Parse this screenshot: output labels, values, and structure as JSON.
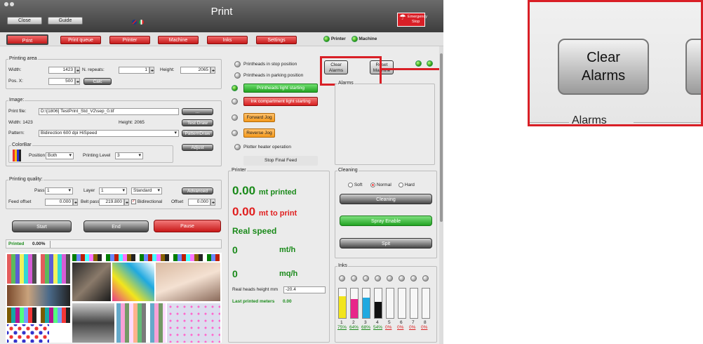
{
  "window": {
    "title": "Print",
    "close_label": "Close",
    "guide_label": "Guide"
  },
  "emergency": {
    "label_line1": "Emergency",
    "label_line2": "Stop"
  },
  "tabs": [
    "Print",
    "Print queue",
    "Printer",
    "Machine",
    "Inks",
    "Settings"
  ],
  "status": {
    "printer": "Printer",
    "machine": "Machine"
  },
  "printing_area": {
    "legend": "Printing area",
    "width_label": "Width:",
    "width_value": "1423",
    "repeats_label": "N. repeats:",
    "repeats_value": "1",
    "height_label": "Height:",
    "height_value": "2065",
    "posx_label": "Pos. X:",
    "posx_value": "500",
    "calc_label": "Calc"
  },
  "image": {
    "legend": "Image:",
    "file_label": "Print file:",
    "file_value": "D:\\[1806] TestPrint_Std_V2\\sep_0.tif",
    "browse_label": "...",
    "width_text": "Width: 1423",
    "height_text": "Height: 2065",
    "test_draw": "Test Draw",
    "pattern_label": "Pattern:",
    "pattern_value": "Bidirection 600 dpi HiSpeed",
    "pattern_draw": "PatternDraw",
    "adjust": "Adjust",
    "colorbar_legend": "ColorBar",
    "position_label": "Position",
    "position_value": "Both",
    "level_label": "Printing Level",
    "level_value": "3"
  },
  "quality": {
    "legend": "Printing quality:",
    "pass_label": "Pass",
    "pass_value": "1",
    "layer_label": "Layer",
    "layer_value": "1",
    "mode_value": "Standard",
    "advanced": "Advanced",
    "feed_label": "Feed offset",
    "feed_value": "0.000",
    "belt_label": "Belt pass",
    "belt_value": "219.800",
    "bidirectional": "Bidirectional",
    "offset_label": "Offset",
    "offset_value": "0.000"
  },
  "controls": {
    "start": "Start",
    "end": "End",
    "pause": "Pause"
  },
  "progress": {
    "label": "Printed",
    "value": "0.00%"
  },
  "heads": {
    "stop": "Printheads in stop position",
    "parking": "Printheads in parking position",
    "light": "Printheads light starting",
    "ink_light": "Ink compartment light starting",
    "forward": "Forward Jog",
    "reverse": "Reverse Jog",
    "heater": "Plotter heater operation",
    "stop_feed": "Stop Final Feed"
  },
  "alarm_buttons": {
    "clear_line1": "Clear",
    "clear_line2": "Alarms",
    "reset_line1": "Reset",
    "reset_line2": "Machine",
    "alarms_legend": "Alarms"
  },
  "printer_panel": {
    "legend": "Printer",
    "printed_value": "0.00",
    "printed_unit": "mt printed",
    "toprint_value": "0.00",
    "toprint_unit": "mt to print",
    "speed_label": "Real speed",
    "mth_value": "0",
    "mth_unit": "mt/h",
    "mqh_value": "0",
    "mqh_unit": "mq/h",
    "heads_height_label": "Real heads height mm",
    "heads_height_value": "-20.4",
    "last_printed": "Last printed meters",
    "last_value": "0.00"
  },
  "cleaning": {
    "legend": "Cleaning",
    "soft": "Soft",
    "normal": "Normal",
    "hard": "Hard",
    "cleaning_btn": "Cleaning",
    "spray": "Spray Enable",
    "spit": "Spit"
  },
  "inks": {
    "legend": "Inks",
    "channels": [
      {
        "n": "1",
        "pct": "75%",
        "level": 0.75,
        "color": "#f2e51c"
      },
      {
        "n": "2",
        "pct": "64%",
        "level": 0.64,
        "color": "#e8268a"
      },
      {
        "n": "3",
        "pct": "68%",
        "level": 0.68,
        "color": "#1fa9e0"
      },
      {
        "n": "4",
        "pct": "54%",
        "level": 0.54,
        "color": "#111111"
      },
      {
        "n": "5",
        "pct": "0%",
        "level": 0,
        "color": "#999999"
      },
      {
        "n": "6",
        "pct": "0%",
        "level": 0,
        "color": "#999999"
      },
      {
        "n": "7",
        "pct": "0%",
        "level": 0,
        "color": "#999999"
      },
      {
        "n": "8",
        "pct": "0%",
        "level": 0,
        "color": "#999999"
      }
    ]
  },
  "zoom": {
    "clear_line1": "Clear",
    "clear_line2": "Alarms",
    "alarms_label": "Alarms"
  },
  "colors": {
    "accent_red": "#d91f26",
    "led_green": "#2e9c0c"
  }
}
